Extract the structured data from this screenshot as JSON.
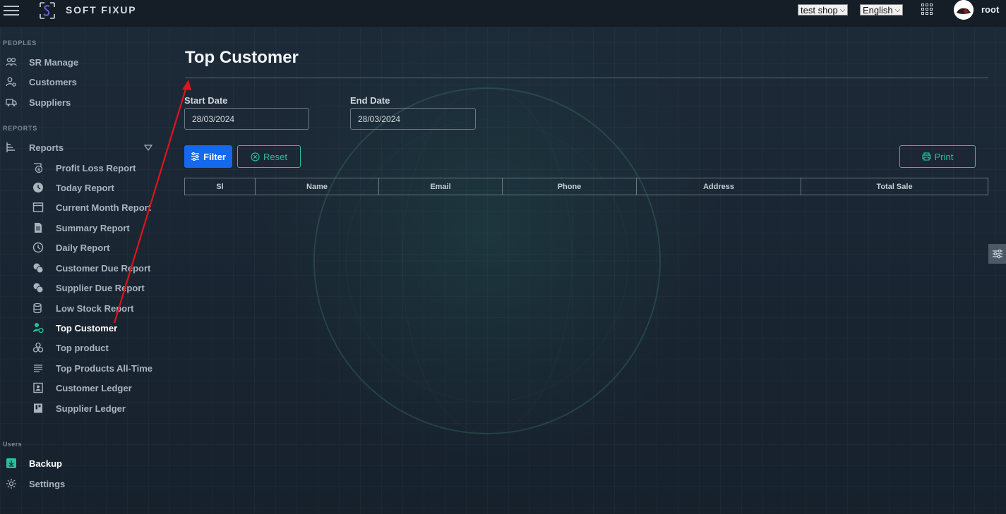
{
  "app": {
    "brand": "SOFT FIXUP"
  },
  "topbar": {
    "shop_select": "test shop",
    "language_select": "English",
    "user_name": "root"
  },
  "sidebar": {
    "sections": {
      "peoples": "PEOPLES",
      "reports": "REPORTS",
      "users": "Users"
    },
    "people_items": [
      {
        "label": "SR Manage",
        "icon": "users-icon"
      },
      {
        "label": "Customers",
        "icon": "user-gear-icon"
      },
      {
        "label": "Suppliers",
        "icon": "truck-icon"
      }
    ],
    "reports_label": "Reports",
    "report_items": [
      {
        "label": "Profit Loss Report",
        "icon": "profit-icon"
      },
      {
        "label": "Today Report",
        "icon": "clock-icon"
      },
      {
        "label": "Current Month Report",
        "icon": "calendar-icon"
      },
      {
        "label": "Summary Report",
        "icon": "document-icon"
      },
      {
        "label": "Daily Report",
        "icon": "clock-outline-icon"
      },
      {
        "label": "Customer Due Report",
        "icon": "coins-icon"
      },
      {
        "label": "Supplier Due Report",
        "icon": "coins-icon"
      },
      {
        "label": "Low Stock Report",
        "icon": "database-icon"
      },
      {
        "label": "Top Customer",
        "icon": "user-star-icon",
        "active": true
      },
      {
        "label": "Top product",
        "icon": "cubes-icon"
      },
      {
        "label": "Top Products All-Time",
        "icon": "list-icon"
      },
      {
        "label": "Customer Ledger",
        "icon": "contact-book-icon"
      },
      {
        "label": "Supplier Ledger",
        "icon": "ledger-icon"
      }
    ],
    "user_items": [
      {
        "label": "Backup",
        "icon": "download-icon"
      },
      {
        "label": "Settings",
        "icon": "gear-icon"
      }
    ]
  },
  "main": {
    "title": "Top Customer",
    "start_date_label": "Start Date",
    "start_date_value": "28/03/2024",
    "end_date_label": "End Date",
    "end_date_value": "28/03/2024",
    "filter_label": "Filter",
    "reset_label": "Reset",
    "print_label": "Print",
    "table_headers": [
      "Sl",
      "Name",
      "Email",
      "Phone",
      "Address",
      "Total Sale"
    ]
  },
  "colors": {
    "accent_blue": "#1469ec",
    "accent_teal": "#2bbf9a",
    "annotation_arrow": "#e0141c"
  }
}
